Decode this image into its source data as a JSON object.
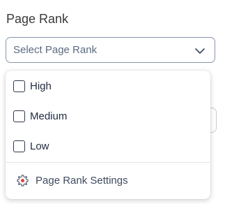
{
  "field": {
    "label": "Page Rank",
    "placeholder": "Select Page Rank"
  },
  "menu": {
    "options": [
      {
        "label": "High",
        "checked": false
      },
      {
        "label": "Medium",
        "checked": false
      },
      {
        "label": "Low",
        "checked": false
      }
    ],
    "settings_label": "Page Rank Settings"
  },
  "icons": {
    "dropdown": "chevron-down-icon",
    "settings": "gear-icon"
  },
  "colors": {
    "accent": "#e0453c",
    "border": "#8796ab",
    "text": "#1f2a40"
  }
}
